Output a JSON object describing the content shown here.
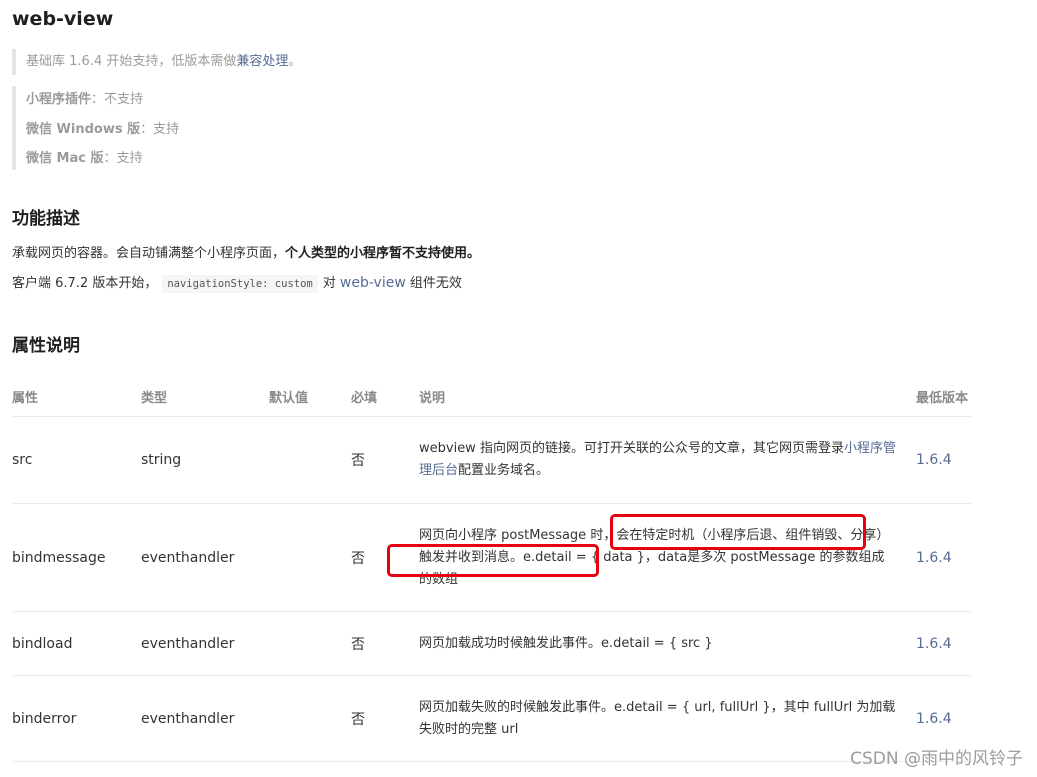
{
  "title": "web-view",
  "support": {
    "base_prefix": "基础库 1.6.4 开始支持，低版本需做",
    "compat_link": "兼容处理",
    "base_suffix": "。",
    "plugin_label": "小程序插件",
    "plugin_value": "：不支持",
    "windows_label": "微信 Windows 版",
    "windows_value": "：支持",
    "mac_label": "微信 Mac 版",
    "mac_value": "：支持"
  },
  "func": {
    "heading": "功能描述",
    "line1_plain": "承载网页的容器。会自动铺满整个小程序页面，",
    "line1_bold": "个人类型的小程序暂不支持使用。",
    "line2_prefix": "客户端 6.7.2 版本开始，",
    "line2_code": "navigationStyle: custom",
    "line2_mid": "对",
    "line2_link": "web-view",
    "line2_suffix": "组件无效"
  },
  "attrs": {
    "heading": "属性说明",
    "columns": [
      "属性",
      "类型",
      "默认值",
      "必填",
      "说明",
      "最低版本"
    ],
    "rows": [
      {
        "name": "src",
        "type": "string",
        "default": "",
        "required": "否",
        "desc_a": "webview 指向网页的链接。可打开关联的公众号的文章，其它网页需登录",
        "desc_link": "小程序管理后台",
        "desc_b": "配置业务域名。",
        "version": "1.6.4"
      },
      {
        "name": "bindmessage",
        "type": "eventhandler",
        "default": "",
        "required": "否",
        "desc_a": "网页向小程序 postMessage 时，会在特定时机（小程序后退、组件销毁、分享）触发并收到消息。e.detail = { data }，data是多次 postMessage 的参数组成的数组",
        "version": "1.6.4"
      },
      {
        "name": "bindload",
        "type": "eventhandler",
        "default": "",
        "required": "否",
        "desc_a": "网页加载成功时候触发此事件。e.detail = { src }",
        "version": "1.6.4"
      },
      {
        "name": "binderror",
        "type": "eventhandler",
        "default": "",
        "required": "否",
        "desc_a": "网页加载失败的时候触发此事件。e.detail = { url, fullUrl }，其中 fullUrl 为加载失败时的完整 url",
        "version": "1.6.4"
      }
    ]
  },
  "watermark": "CSDN @雨中的风铃子",
  "colors": {
    "link": "#576b95",
    "highlight": "#e60012"
  }
}
